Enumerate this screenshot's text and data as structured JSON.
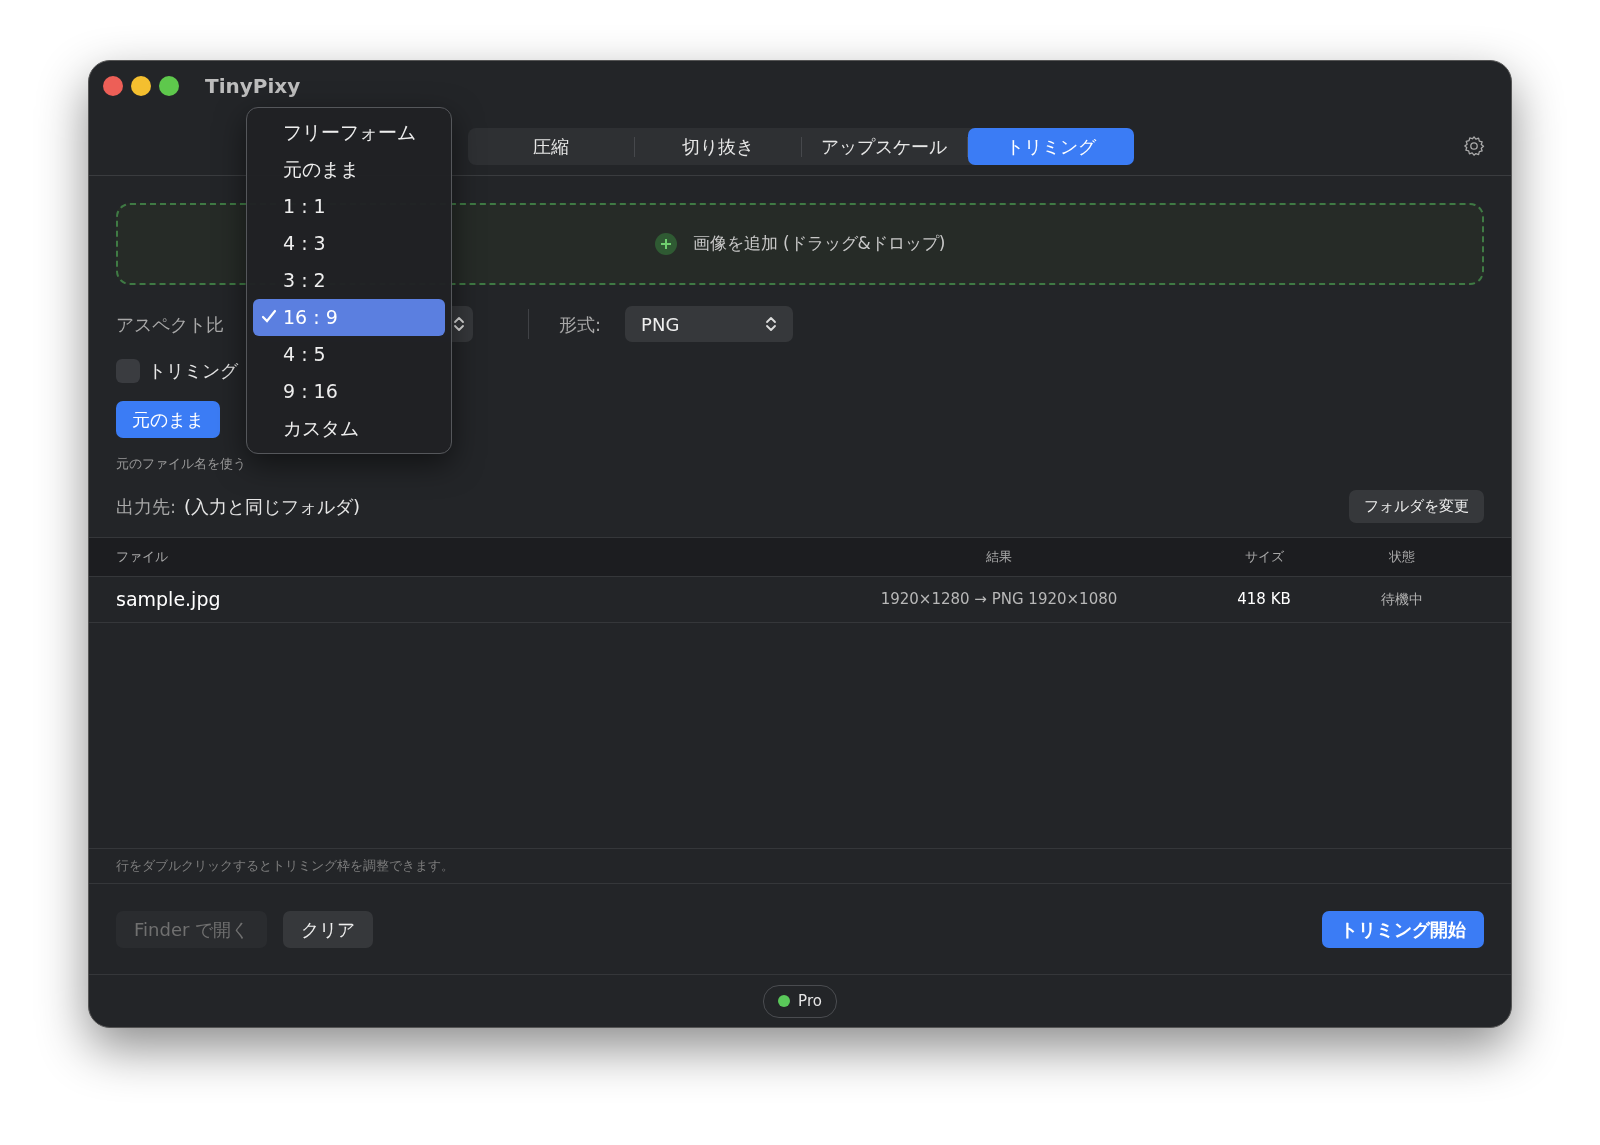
{
  "window": {
    "title": "TinyPixy"
  },
  "tabs": [
    {
      "label": "圧縮",
      "selected": false
    },
    {
      "label": "切り抜き",
      "selected": false
    },
    {
      "label": "アップスケール",
      "selected": false
    },
    {
      "label": "トリミング",
      "selected": true
    }
  ],
  "drop_zone": {
    "label": "画像を追加 (ドラッグ&ドロップ)"
  },
  "aspect_ratio": {
    "label": "アスペクト比"
  },
  "format": {
    "label": "形式:",
    "value": "PNG"
  },
  "trim_checkbox": {
    "label": "トリミング",
    "checked": false
  },
  "naming_segments": [
    {
      "label": "元のまま",
      "selected": true
    }
  ],
  "naming_caption": "元のファイル名を使う",
  "output": {
    "label": "出力先:",
    "value": "(入力と同じフォルダ)",
    "button": "フォルダを変更"
  },
  "table": {
    "columns": [
      "ファイル",
      "結果",
      "サイズ",
      "状態"
    ],
    "rows": [
      {
        "file": "sample.jpg",
        "result": "1920×1280 → PNG 1920×1080",
        "size": "418 KB",
        "status": "待機中"
      }
    ]
  },
  "hint": "行をダブルクリックするとトリミング枠を調整できます。",
  "buttons": [
    {
      "label": "Finder で開く",
      "disabled": true,
      "primary": false
    },
    {
      "label": "クリア",
      "disabled": false,
      "primary": false
    },
    {
      "label": "トリミング開始",
      "disabled": false,
      "primary": true
    }
  ],
  "plan_badge": {
    "label": "Pro"
  },
  "aspect_menu": {
    "items": [
      {
        "label": "フリーフォーム",
        "selected": false
      },
      {
        "label": "元のまま",
        "selected": false
      },
      {
        "label": "1 : 1",
        "selected": false
      },
      {
        "label": "4 : 3",
        "selected": false
      },
      {
        "label": "3 : 2",
        "selected": false
      },
      {
        "label": "16 : 9",
        "selected": true
      },
      {
        "label": "4 : 5",
        "selected": false
      },
      {
        "label": "9 : 16",
        "selected": false
      },
      {
        "label": "カスタム",
        "selected": false
      }
    ]
  }
}
